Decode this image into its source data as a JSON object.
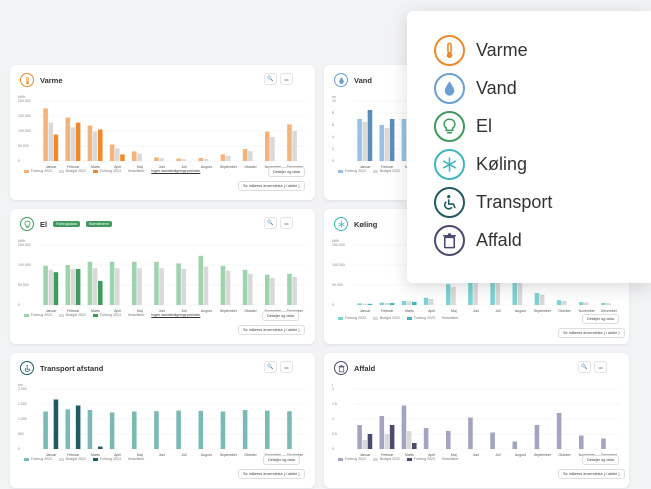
{
  "menu": {
    "items": [
      {
        "label": "Varme",
        "icon": "thermometer-icon",
        "color": "#e88a2e"
      },
      {
        "label": "Vand",
        "icon": "water-drop-icon",
        "color": "#6a9fd0"
      },
      {
        "label": "El",
        "icon": "lightbulb-icon",
        "color": "#3f9a5c"
      },
      {
        "label": "Køling",
        "icon": "snowflake-icon",
        "color": "#3fb6bd"
      },
      {
        "label": "Transport",
        "icon": "wheelchair-icon",
        "color": "#1e5b62"
      },
      {
        "label": "Affald",
        "icon": "trash-icon",
        "color": "#4a4a6e"
      }
    ]
  },
  "ui": {
    "search_icon": "🔍",
    "more_icon": "•••",
    "details_button": "Detaljer og data",
    "more_months_button": "Se måleres anvendelse ( i aktier )"
  },
  "cards": {
    "varme": {
      "title": "Varme",
      "unit": "kWh",
      "yticks": [
        "200.000",
        "150.000",
        "100.000",
        "50.000",
        "0"
      ],
      "legend": [
        "Forbrug 2022",
        "Budget 2022",
        "Forbrug 2023",
        "Historikker",
        "Ingen sammenlignings perioder"
      ],
      "more_button": "Se måleres anvendelse ( i aktier )"
    },
    "vand": {
      "title": "Vand",
      "unit": "m³",
      "yticks": [
        "10",
        "8",
        "6",
        "4",
        "2",
        "0"
      ],
      "legend": [
        "Forbrug 2022",
        "Budget 2022",
        "Forbrug 2023"
      ]
    },
    "el": {
      "title": "El",
      "tags": [
        "Forbrugsdata",
        "Normaliseret"
      ],
      "unit": "kWh",
      "yticks": [
        "150.000",
        "100.000",
        "50.000",
        "0"
      ],
      "legend": [
        "Forbrug 2022",
        "Budget 2022",
        "Forbrug 2023",
        "Historikker",
        "Ingen sammenlignings perioder"
      ],
      "more_button": "Se måleres anvendelse ( i aktier )"
    },
    "koling": {
      "title": "Køling",
      "unit": "kWh",
      "yticks": [
        "150.000",
        "100.000",
        "50.000",
        "0"
      ],
      "legend": [
        "Forbrug 2022",
        "Budget 2022",
        "Forbrug 2023",
        "Historikker"
      ],
      "more_button": "Se måleres anvendelse ( i aktier )"
    },
    "transport": {
      "title": "Transport afstand",
      "unit": "km",
      "yticks": [
        "2.000",
        "1.500",
        "1.000",
        "500",
        "0"
      ],
      "legend": [
        "Forbrug 2022",
        "Budget 2022",
        "Forbrug 2023",
        "Historikker"
      ],
      "more_button": "Se måleres anvendelse ( i aktier )"
    },
    "affald": {
      "title": "Affald",
      "unit": "t",
      "yticks": [
        "2",
        "1.5",
        "1",
        "0.5",
        "0"
      ],
      "legend": [
        "Forbrug 2022",
        "Budget 2022",
        "Forbrug 2023",
        "Historikker"
      ],
      "more_button": "Se måleres anvendelse ( i aktier )"
    }
  },
  "chart_data": [
    {
      "type": "bar",
      "id": "varme",
      "categories": [
        "Januar",
        "Februar",
        "Marts",
        "April",
        "Maj",
        "Juni",
        "Juli",
        "August",
        "September",
        "Oktober",
        "November",
        "December"
      ],
      "ylim": [
        0,
        200000
      ],
      "colors": [
        "#f4b37a",
        "#d9d9d9",
        "#ef8a2a"
      ],
      "series": [
        {
          "name": "Forbrug 2022",
          "values": [
            175000,
            145000,
            118000,
            55000,
            32000,
            12000,
            8000,
            10000,
            22000,
            40000,
            98000,
            122000
          ]
        },
        {
          "name": "Budget 2022",
          "values": [
            128000,
            112000,
            98000,
            42000,
            25000,
            9000,
            6000,
            7000,
            17000,
            33000,
            80000,
            100000
          ]
        },
        {
          "name": "Forbrug 2023",
          "values": [
            88000,
            128000,
            105000,
            22000,
            0,
            0,
            0,
            0,
            0,
            0,
            0,
            0
          ]
        }
      ]
    },
    {
      "type": "bar",
      "id": "vand",
      "categories": [
        "Januar",
        "Februar",
        "Marts",
        "April",
        "Maj",
        "Juni",
        "Juli",
        "August",
        "September",
        "Oktober",
        "November",
        "December"
      ],
      "ylim": [
        0,
        10
      ],
      "colors": [
        "#9bc1e2",
        "#d9d9d9",
        "#5b8db8"
      ],
      "series": [
        {
          "name": "Forbrug 2022",
          "values": [
            7,
            6,
            7,
            5
          ]
        },
        {
          "name": "Budget 2022",
          "values": [
            6.5,
            5.5,
            6,
            4.5
          ]
        },
        {
          "name": "Forbrug 2023",
          "values": [
            8.5,
            7,
            7.5,
            5.5
          ]
        }
      ]
    },
    {
      "type": "bar",
      "id": "el",
      "categories": [
        "Januar",
        "Februar",
        "Marts",
        "April",
        "Maj",
        "Juni",
        "Juli",
        "August",
        "September",
        "Oktober",
        "November",
        "December"
      ],
      "ylim": [
        0,
        150000
      ],
      "colors": [
        "#9fd3ac",
        "#d9d9d9",
        "#3f9a5c"
      ],
      "series": [
        {
          "name": "Forbrug 2022",
          "values": [
            98000,
            100000,
            108000,
            108000,
            108000,
            108000,
            104000,
            123000,
            98000,
            88000,
            76000,
            78000
          ]
        },
        {
          "name": "Budget 2022",
          "values": [
            88000,
            90000,
            92000,
            92000,
            92000,
            92000,
            90000,
            96000,
            86000,
            78000,
            68000,
            70000
          ]
        },
        {
          "name": "Forbrug 2023",
          "values": [
            82000,
            90000,
            60000,
            0,
            0,
            0,
            0,
            0,
            0,
            0,
            0,
            0
          ]
        }
      ]
    },
    {
      "type": "bar",
      "id": "koling",
      "categories": [
        "Januar",
        "Februar",
        "Marts",
        "April",
        "Maj",
        "Juni",
        "Juli",
        "August",
        "September",
        "Oktober",
        "November",
        "December"
      ],
      "ylim": [
        0,
        150000
      ],
      "colors": [
        "#7fd1d6",
        "#d9d9d9",
        "#3fb6bd"
      ],
      "series": [
        {
          "name": "Forbrug 2022",
          "values": [
            4000,
            6000,
            10000,
            18000,
            52000,
            70000,
            75000,
            62000,
            30000,
            12000,
            7000,
            5000
          ]
        },
        {
          "name": "Budget 2022",
          "values": [
            3500,
            5000,
            9000,
            15000,
            45000,
            60000,
            65000,
            55000,
            26000,
            10000,
            6000,
            4500
          ]
        },
        {
          "name": "Forbrug 2023",
          "values": [
            3000,
            5000,
            8000,
            0,
            0,
            0,
            0,
            0,
            0,
            0,
            0,
            0
          ]
        }
      ]
    },
    {
      "type": "bar",
      "id": "transport",
      "categories": [
        "Januar",
        "Februar",
        "Marts",
        "April",
        "Maj",
        "Juni",
        "Juli",
        "August",
        "September",
        "Oktober",
        "November",
        "December"
      ],
      "ylim": [
        0,
        2000
      ],
      "colors": [
        "#7bb9b5",
        "#d9d9d9",
        "#1e5b62"
      ],
      "series": [
        {
          "name": "Forbrug 2022",
          "values": [
            1250,
            1320,
            1300,
            1220,
            1250,
            1260,
            1280,
            1270,
            1250,
            1300,
            1280,
            1260
          ]
        },
        {
          "name": "Budget 2022",
          "values": [
            0,
            0,
            0,
            0,
            0,
            0,
            0,
            0,
            0,
            0,
            0,
            0
          ]
        },
        {
          "name": "Forbrug 2023",
          "values": [
            1650,
            1450,
            80,
            0,
            0,
            0,
            0,
            0,
            0,
            0,
            0,
            0
          ]
        }
      ]
    },
    {
      "type": "bar",
      "id": "affald",
      "categories": [
        "Januar",
        "Februar",
        "Marts",
        "April",
        "Maj",
        "Juni",
        "Juli",
        "August",
        "September",
        "Oktober",
        "November",
        "December"
      ],
      "ylim": [
        0,
        2
      ],
      "colors": [
        "#a3a3c2",
        "#d9d9d9",
        "#4a4a6e"
      ],
      "series": [
        {
          "name": "Forbrug 2022",
          "values": [
            0.8,
            1.1,
            1.45,
            0.7,
            0.6,
            1.05,
            0.55,
            0.25,
            0.8,
            1.2,
            0.45,
            0.35
          ]
        },
        {
          "name": "Budget 2022",
          "values": [
            0.3,
            0.5,
            0.6,
            0,
            0,
            0,
            0,
            0,
            0,
            0,
            0,
            0
          ]
        },
        {
          "name": "Forbrug 2023",
          "values": [
            0.5,
            0.8,
            0.2,
            0,
            0,
            0,
            0,
            0,
            0,
            0,
            0,
            0
          ]
        }
      ]
    }
  ]
}
